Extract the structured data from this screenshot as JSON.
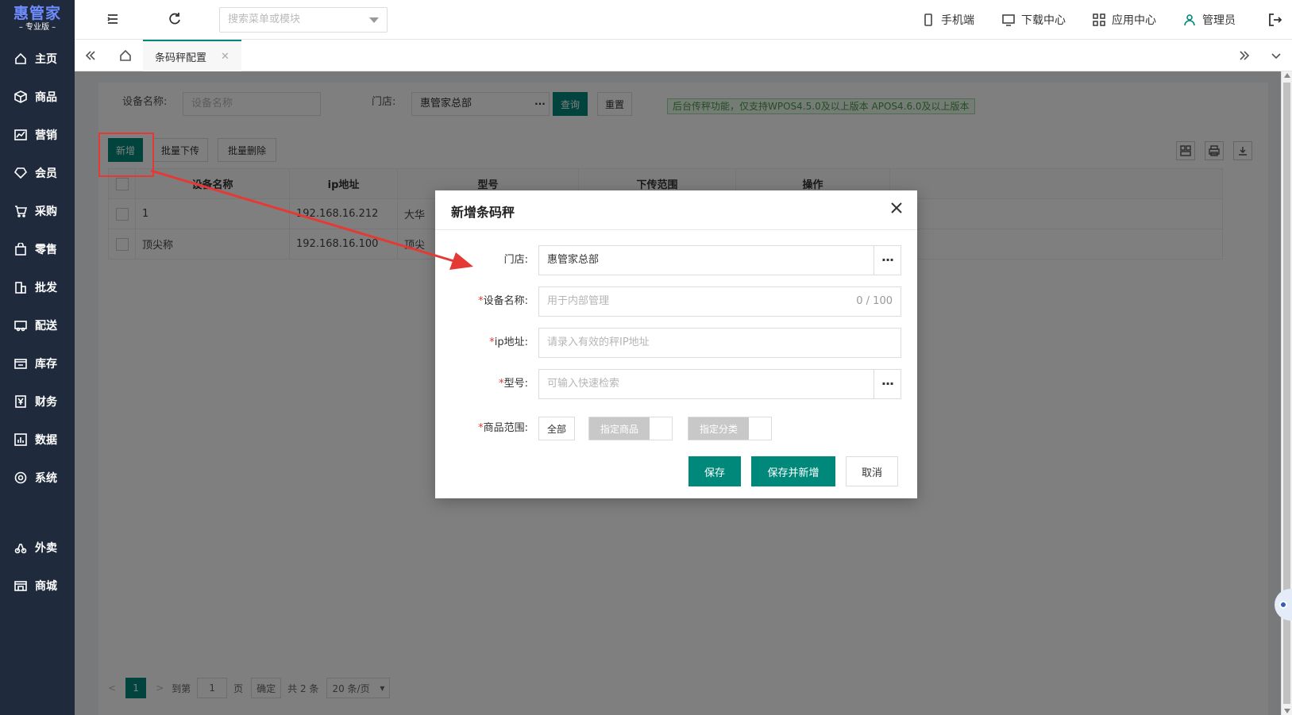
{
  "app": {
    "logo_title": "惠管家",
    "logo_subtitle": "– 专业版 –"
  },
  "sidebar": {
    "items": [
      {
        "label": "主页",
        "icon": "home-icon"
      },
      {
        "label": "商品",
        "icon": "box-icon"
      },
      {
        "label": "营销",
        "icon": "chart-icon"
      },
      {
        "label": "会员",
        "icon": "diamond-icon"
      },
      {
        "label": "采购",
        "icon": "cart-icon"
      },
      {
        "label": "零售",
        "icon": "bag-icon"
      },
      {
        "label": "批发",
        "icon": "building-icon"
      },
      {
        "label": "配送",
        "icon": "truck-icon"
      },
      {
        "label": "库存",
        "icon": "warehouse-icon"
      },
      {
        "label": "财务",
        "icon": "yen-icon"
      },
      {
        "label": "数据",
        "icon": "bar-chart-icon"
      },
      {
        "label": "系统",
        "icon": "settings-icon"
      },
      {
        "label": "外卖",
        "icon": "scooter-icon"
      },
      {
        "label": "商城",
        "icon": "store-icon"
      }
    ]
  },
  "topbar": {
    "search_placeholder": "搜索菜单或模块",
    "mobile": "手机端",
    "download": "下载中心",
    "apps": "应用中心",
    "user": "管理员"
  },
  "tabs": {
    "active": "条码秤配置"
  },
  "filter": {
    "device_label": "设备名称:",
    "device_placeholder": "设备名称",
    "store_label": "门店:",
    "store_value": "惠管家总部",
    "more": "···",
    "query": "查询",
    "reset": "重置",
    "notice": "后台传秤功能，仅支持WPOS4.5.0及以上版本 APOS4.6.0及以上版本"
  },
  "toolbar": {
    "add": "新增",
    "batch_download": "批量下传",
    "batch_delete": "批量删除"
  },
  "table": {
    "headers": [
      "设备名称",
      "ip地址",
      "型号",
      "下传范围",
      "操作"
    ],
    "rows": [
      {
        "name": "1",
        "ip": "192.168.16.212",
        "model": "大华"
      },
      {
        "name": "顶尖称",
        "ip": "192.168.16.100",
        "model": "顶尖"
      }
    ]
  },
  "pager": {
    "current": "1",
    "goto": "到第",
    "page_input": "1",
    "page_unit": "页",
    "confirm": "确定",
    "total": "共 2 条",
    "page_size": "20 条/页"
  },
  "dialog": {
    "title": "新增条码秤",
    "store_label": "门店:",
    "store_value": "惠管家总部",
    "name_label": "设备名称:",
    "name_placeholder": "用于内部管理",
    "name_count": "0 / 100",
    "ip_label": "ip地址:",
    "ip_placeholder": "请录入有效的秤IP地址",
    "model_label": "型号:",
    "model_placeholder": "可输入快速检索",
    "range_label": "商品范围:",
    "range_all": "全部",
    "range_goods": "指定商品",
    "range_category": "指定分类",
    "required_mark": "*",
    "more": "···",
    "save": "保存",
    "save_new": "保存并新增",
    "cancel": "取消"
  },
  "colors": {
    "primary": "#00897b",
    "sidebar_bg": "#1f2b3c",
    "annotation": "#e53935"
  }
}
